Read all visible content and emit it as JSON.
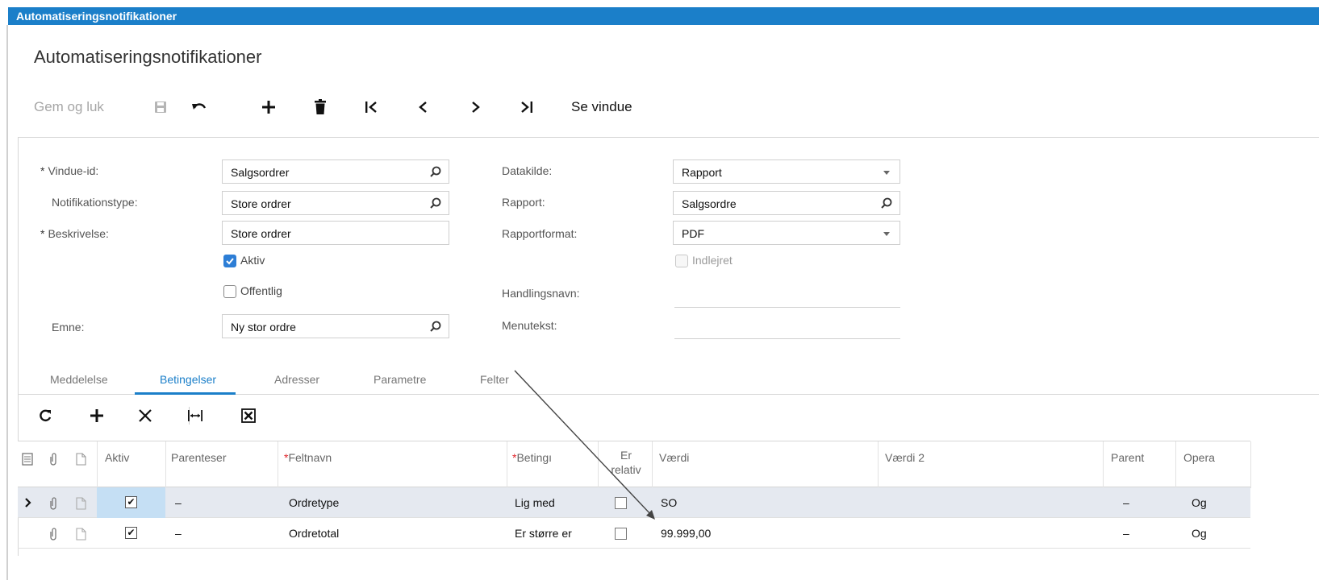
{
  "window": {
    "title": "Automatiseringsnotifikationer"
  },
  "page": {
    "title": "Automatiseringsnotifikationer"
  },
  "toolbar": {
    "save_close": "Gem og luk",
    "view_window": "Se vindue",
    "icons": [
      "save-icon",
      "undo-icon",
      "add-icon",
      "delete-icon",
      "first-icon",
      "previous-icon",
      "next-icon",
      "last-icon"
    ]
  },
  "form": {
    "window_id": {
      "label": "Vindue-id:",
      "value": "Salgsordrer"
    },
    "notification_type": {
      "label": "Notifikationstype:",
      "value": "Store ordrer"
    },
    "description": {
      "label": "Beskrivelse:",
      "value": "Store ordrer"
    },
    "active": {
      "label": "Aktiv",
      "checked": true
    },
    "public": {
      "label": "Offentlig",
      "checked": false
    },
    "subject": {
      "label": "Emne:",
      "value": "Ny stor ordre"
    },
    "data_source": {
      "label": "Datakilde:",
      "value": "Rapport"
    },
    "report": {
      "label": "Rapport:",
      "value": "Salgsordre"
    },
    "report_format": {
      "label": "Rapportformat:",
      "value": "PDF"
    },
    "embedded": {
      "label": "Indlejret",
      "checked": false,
      "disabled": true
    },
    "action_name": {
      "label": "Handlingsnavn:",
      "value": ""
    },
    "menu_text": {
      "label": "Menutekst:",
      "value": ""
    }
  },
  "tabs": [
    {
      "label": "Meddelelse",
      "active": false
    },
    {
      "label": "Betingelser",
      "active": true
    },
    {
      "label": "Adresser",
      "active": false
    },
    {
      "label": "Parametre",
      "active": false
    },
    {
      "label": "Felter",
      "active": false
    }
  ],
  "grid_toolbar": {
    "icons": [
      "refresh-icon",
      "add-row-icon",
      "delete-row-icon",
      "fit-columns-icon",
      "export-excel-icon"
    ]
  },
  "grid": {
    "columns": {
      "aktiv": "Aktiv",
      "parenteser": "Parenteser",
      "feltnavn": "Feltnavn",
      "beting": "Betingı",
      "er_relativ_1": "Er",
      "er_relativ_2": "relativ",
      "vaerdi": "Værdi",
      "vaerdi2": "Værdi 2",
      "parent": "Parent",
      "opera": "Opera"
    },
    "rows": [
      {
        "selected": true,
        "aktiv": true,
        "parenteser": "–",
        "feltnavn": "Ordretype",
        "beting": "Lig med",
        "er_relativ": false,
        "vaerdi": "SO",
        "vaerdi2": "",
        "parent": "–",
        "opera": "Og"
      },
      {
        "selected": false,
        "aktiv": true,
        "parenteser": "–",
        "feltnavn": "Ordretotal",
        "beting": "Er større er",
        "er_relativ": false,
        "vaerdi": "99.999,00",
        "vaerdi2": "",
        "parent": "–",
        "opera": "Og"
      }
    ]
  },
  "colors": {
    "accent": "#1b7fc9",
    "required": "#e0242a",
    "selected_row": "#e5e9f0"
  }
}
